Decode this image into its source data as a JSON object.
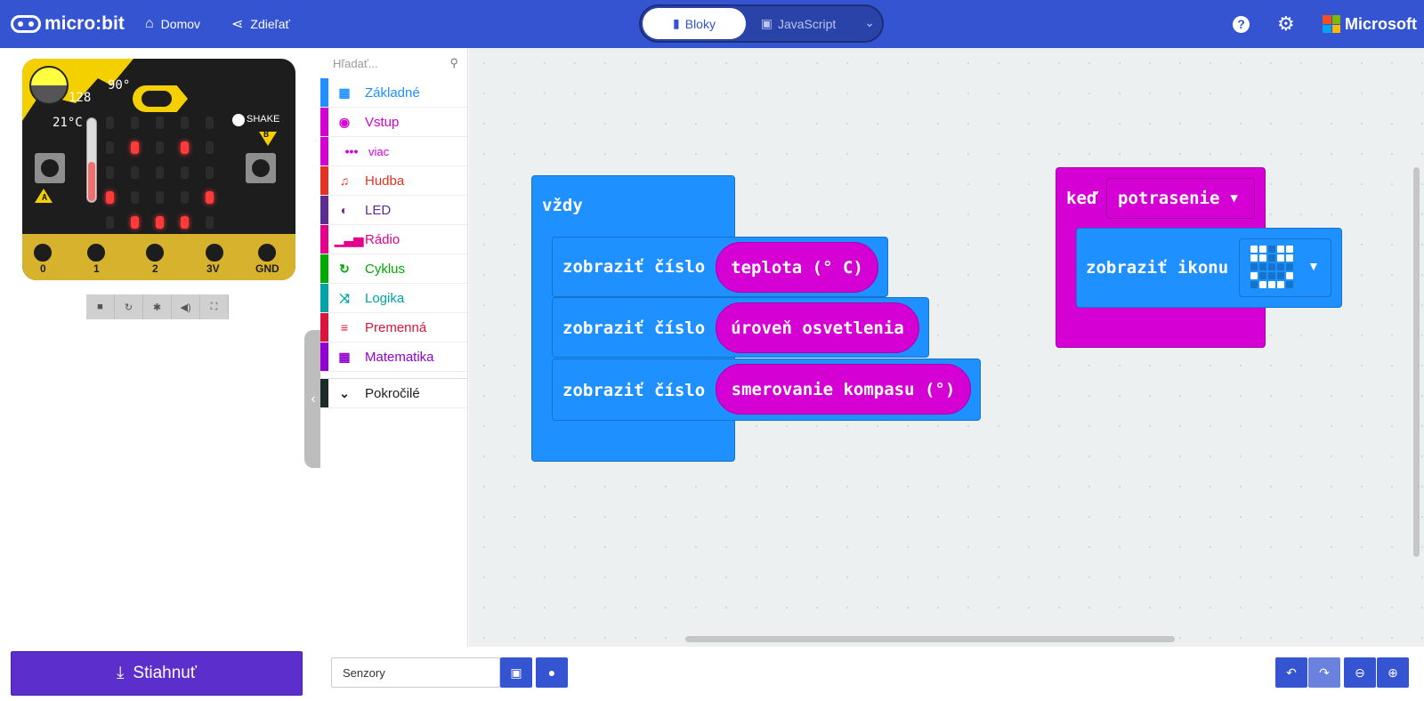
{
  "header": {
    "logo_text": "micro:bit",
    "home_label": "Domov",
    "share_label": "Zdieľať",
    "blocks_label": "Bloky",
    "javascript_label": "JavaScript",
    "microsoft_label": "Microsoft"
  },
  "simulator": {
    "light_level": "128",
    "compass_heading": "90°",
    "temperature": "21°C",
    "shake_label": "SHAKE",
    "button_a": "A",
    "button_b": "B",
    "pins": [
      "0",
      "1",
      "2",
      "3V",
      "GND"
    ],
    "led_on": [
      [
        1,
        1
      ],
      [
        3,
        1
      ],
      [
        0,
        3
      ],
      [
        4,
        3
      ],
      [
        1,
        4
      ],
      [
        2,
        4
      ],
      [
        3,
        4
      ]
    ]
  },
  "toolbox": {
    "search_placeholder": "Hľadať...",
    "categories": [
      {
        "label": "Základné",
        "color": "#1e90ff"
      },
      {
        "label": "Vstup",
        "color": "#d400d4"
      },
      {
        "label": "viac",
        "color": "#d400d4"
      },
      {
        "label": "Hudba",
        "color": "#e63022"
      },
      {
        "label": "LED",
        "color": "#5c2d91"
      },
      {
        "label": "Rádio",
        "color": "#e3008c"
      },
      {
        "label": "Cyklus",
        "color": "#00aa00"
      },
      {
        "label": "Logika",
        "color": "#00a4a6"
      },
      {
        "label": "Premenná",
        "color": "#dc143c"
      },
      {
        "label": "Matematika",
        "color": "#9400d3"
      },
      {
        "label": "Pokročilé",
        "color": "#1d1d1d"
      }
    ]
  },
  "workspace": {
    "forever_label": "vždy",
    "show_number_label": "zobraziť číslo",
    "values": [
      "teplota (° C)",
      "úroveň osvetlenia",
      "smerovanie kompasu (°)"
    ],
    "on_label": "keď",
    "gesture": "potrasenie",
    "show_icon_label": "zobraziť ikonu"
  },
  "footer": {
    "download_label": "Stiahnuť",
    "project_name": "Senzory"
  }
}
